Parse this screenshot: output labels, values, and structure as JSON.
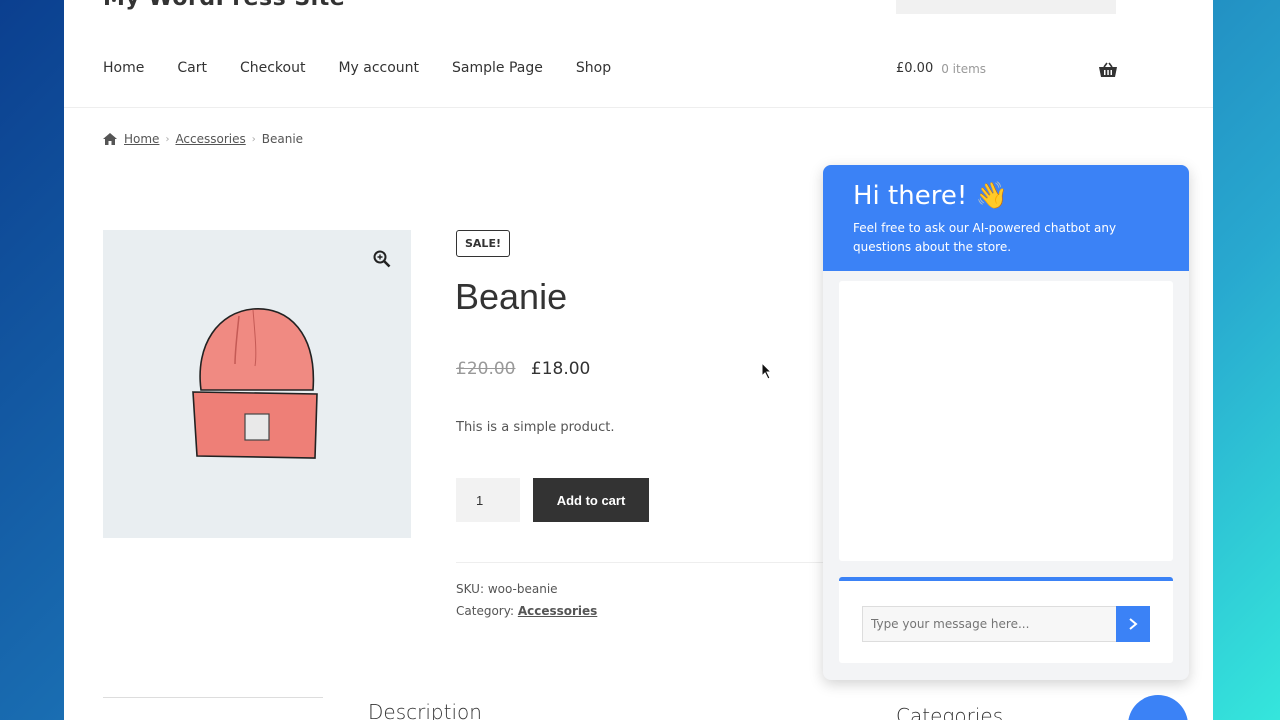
{
  "site": {
    "title": "My WordPress Site"
  },
  "nav": [
    "Home",
    "Cart",
    "Checkout",
    "My account",
    "Sample Page",
    "Shop"
  ],
  "header_cart": {
    "amount": "£0.00",
    "items": "0 items"
  },
  "breadcrumb": {
    "home": "Home",
    "category": "Accessories",
    "current": "Beanie"
  },
  "product": {
    "badge": "SALE!",
    "title": "Beanie",
    "old_price": "£20.00",
    "price": "£18.00",
    "short_description": "This is a simple product.",
    "quantity": "1",
    "add_to_cart": "Add to cart",
    "sku_label": "SKU:",
    "sku": "woo-beanie",
    "category_label": "Category:",
    "category": "Accessories"
  },
  "tabs": {
    "description": "Description"
  },
  "sidebar": {
    "categories": "Categories"
  },
  "chat": {
    "title": "Hi there! 👋",
    "subtitle": "Feel free to ask our AI-powered chatbot any questions about the store.",
    "placeholder": "Type your message here...",
    "accent": "#3b82f6"
  },
  "icons": [
    "home-icon",
    "zoom-icon",
    "basket-icon",
    "send-arrow-icon"
  ]
}
